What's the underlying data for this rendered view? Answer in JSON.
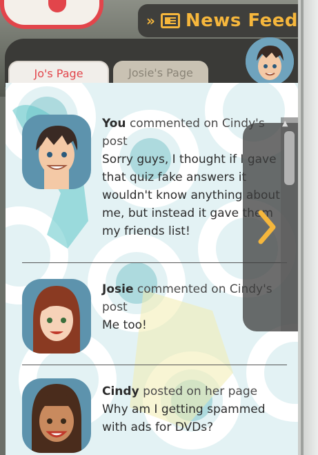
{
  "header": {
    "chevrons": "»",
    "title": "News Feed",
    "icon": "newspaper-icon"
  },
  "tabs": [
    {
      "label": "Jo's Page",
      "active": true
    },
    {
      "label": "Josie's Page",
      "active": false
    }
  ],
  "feed": [
    {
      "author": "You",
      "action": "commented on Cindy's post",
      "message": "Sorry guys, I thought if I gave that quiz fake answers it wouldn't know anything about me, but instead it gave them my friends list!"
    },
    {
      "author": "Josie",
      "action": "commented on Cindy's post",
      "message": "Me too!"
    },
    {
      "author": "Cindy",
      "action": "posted on her page",
      "message": "Why am I getting spammed with ads for DVDs?"
    }
  ],
  "colors": {
    "accent_orange": "#f6b73c",
    "accent_red": "#e2454b",
    "content_bg": "#e3f2f4"
  }
}
